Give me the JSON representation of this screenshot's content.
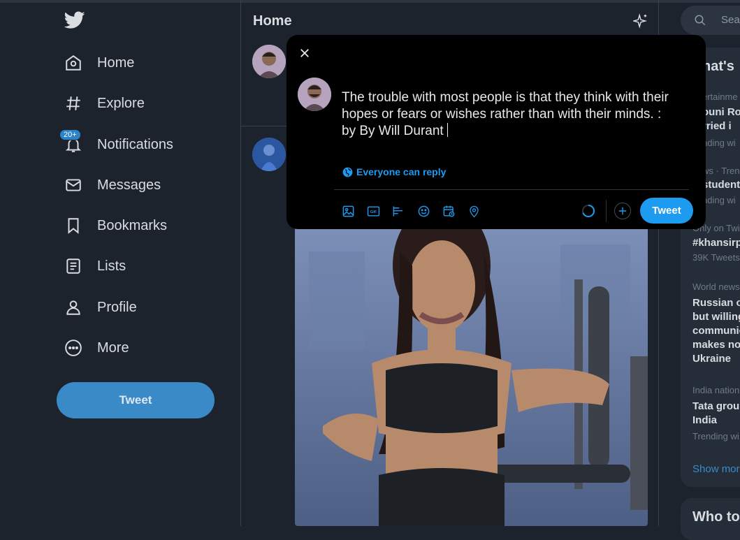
{
  "nav": {
    "items": [
      {
        "label": "Home",
        "icon": "home-icon"
      },
      {
        "label": "Explore",
        "icon": "hashtag-icon"
      },
      {
        "label": "Notifications",
        "icon": "bell-icon",
        "badge": "20+"
      },
      {
        "label": "Messages",
        "icon": "mail-icon"
      },
      {
        "label": "Bookmarks",
        "icon": "bookmark-icon"
      },
      {
        "label": "Lists",
        "icon": "list-icon"
      },
      {
        "label": "Profile",
        "icon": "person-icon"
      },
      {
        "label": "More",
        "icon": "more-icon"
      }
    ],
    "tweet_label": "Tweet"
  },
  "main": {
    "title": "Home"
  },
  "sidebar": {
    "search_placeholder": "Sear",
    "trends_header": "hat's",
    "trends": [
      {
        "context": "ertainme",
        "title1": "ouni Roy",
        "title2": "rried i",
        "meta": "nding wi"
      },
      {
        "context": "ws · Tren",
        "title1": "student",
        "meta": "nding wi"
      },
      {
        "context": "Only on Twi",
        "title1": "#khansirp",
        "meta": "39K Tweets"
      },
      {
        "context": "World news",
        "title1": "Russian o",
        "title2": "but willing",
        "title3": "communic",
        "title4": "makes no",
        "title5": "Ukraine"
      },
      {
        "context": "India nation",
        "title1": "Tata group",
        "title2": "India",
        "meta": "Trending wi"
      }
    ],
    "show_more": "Show mor",
    "who_to_follow": "Who to"
  },
  "composer": {
    "text": "The trouble with most people is that they think with their hopes or fears or wishes rather than with their minds. : by By Will Durant",
    "reply_setting": "Everyone can reply",
    "tweet_label": "Tweet",
    "gif_label": "GIF"
  },
  "colors": {
    "accent": "#1d9bf0",
    "background": "#1c232d",
    "modal": "#000000"
  }
}
